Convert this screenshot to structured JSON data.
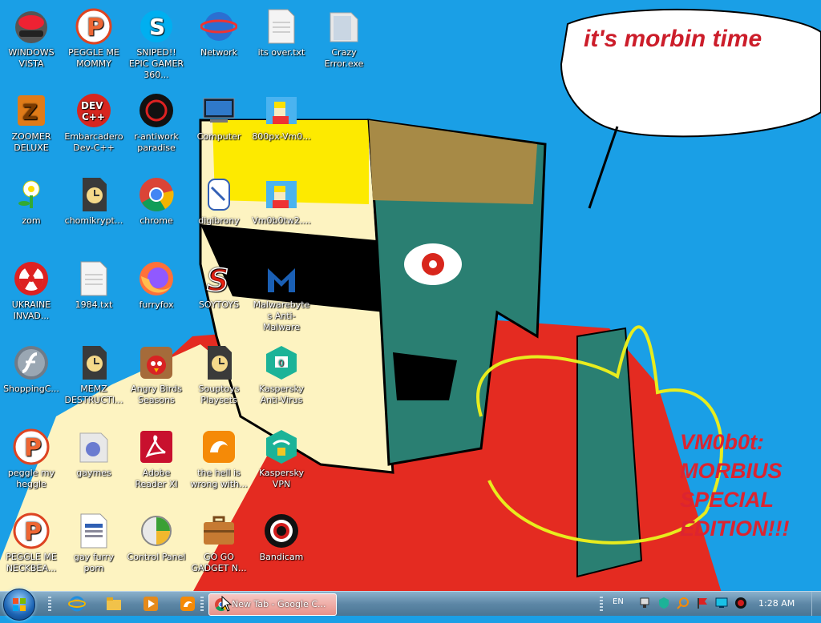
{
  "wallpaper": {
    "speech_bubble_text": "it's morbin time",
    "edition_lines": [
      "VM0b0t:",
      "MORBIUS",
      "SPECIAL",
      "EDITION!!!"
    ]
  },
  "icons": [
    {
      "label": "WINDOWS VISTA",
      "icon": "vista-helmet-icon"
    },
    {
      "label": "PEGGLE ME MOMMY",
      "icon": "peggle-icon"
    },
    {
      "label": "SNIPED!! EPIC GAMER 360...",
      "icon": "skype-icon"
    },
    {
      "label": "Network",
      "icon": "network-globe-icon"
    },
    {
      "label": "its over.txt",
      "icon": "text-file-icon"
    },
    {
      "label": "Crazy Error.exe",
      "icon": "folder-icon"
    },
    {
      "label": "ZOOMER DELUXE",
      "icon": "zuma-icon"
    },
    {
      "label": "Embarcadero Dev-C++",
      "icon": "devcpp-icon"
    },
    {
      "label": "r-antiwork paradise",
      "icon": "antiwork-icon"
    },
    {
      "label": "Computer",
      "icon": "computer-icon"
    },
    {
      "label": "800px-Vm0...",
      "icon": "image-file-icon"
    },
    {
      "label": "zom",
      "icon": "plants-vs-zombies-icon"
    },
    {
      "label": "chomikrypt...",
      "icon": "hourglass-shortcut-icon"
    },
    {
      "label": "chrome",
      "icon": "chrome-icon"
    },
    {
      "label": "digibrony",
      "icon": "digibrony-icon"
    },
    {
      "label": "Vm0b0tw2....",
      "icon": "image-file-icon"
    },
    {
      "label": "UKRAINE INVAD...",
      "icon": "radiation-icon"
    },
    {
      "label": "1984.txt",
      "icon": "text-file-icon"
    },
    {
      "label": "furryfox",
      "icon": "firefox-icon"
    },
    {
      "label": "SOYTOYS",
      "icon": "soytoys-icon"
    },
    {
      "label": "Malwarebytes Anti-Malware",
      "icon": "malwarebytes-icon"
    },
    {
      "label": "ShoppingC...",
      "icon": "flash-icon"
    },
    {
      "label": "MEMZ DESTRUCTI...",
      "icon": "hourglass-shortcut-icon"
    },
    {
      "label": "Angry Birds Seasons",
      "icon": "angry-birds-icon"
    },
    {
      "label": "Souptoys Playsets",
      "icon": "hourglass-shortcut-icon"
    },
    {
      "label": "Kaspersky Anti-Virus",
      "icon": "kaspersky-icon"
    },
    {
      "label": "peggle my heggle",
      "icon": "peggle-icon"
    },
    {
      "label": "gaymes",
      "icon": "games-folder-icon"
    },
    {
      "label": "Adobe Reader XI",
      "icon": "adobe-reader-icon"
    },
    {
      "label": "the hell is wrong with...",
      "icon": "uc-browser-icon"
    },
    {
      "label": "Kaspersky VPN",
      "icon": "kaspersky-vpn-icon"
    },
    {
      "label": "PEGGLE ME NECKBEA...",
      "icon": "peggle-icon"
    },
    {
      "label": "gay furry porn",
      "icon": "document-icon"
    },
    {
      "label": "Control Panel",
      "icon": "control-panel-icon"
    },
    {
      "label": "GO GO GADGET N...",
      "icon": "briefcase-icon"
    },
    {
      "label": "Bandicam",
      "icon": "bandicam-icon"
    }
  ],
  "taskbar": {
    "active_task_label": "New Tab - Google C...",
    "language": "EN",
    "clock": "1:28 AM",
    "quick_launch": [
      "internet-explorer-icon",
      "explorer-folder-icon",
      "media-player-icon",
      "uc-browser-icon"
    ],
    "tray_icons": [
      "network-tray-icon",
      "shield-tray-icon",
      "search-tray-icon",
      "flag-tray-icon",
      "monitor-tray-icon",
      "recorder-tray-icon"
    ]
  }
}
